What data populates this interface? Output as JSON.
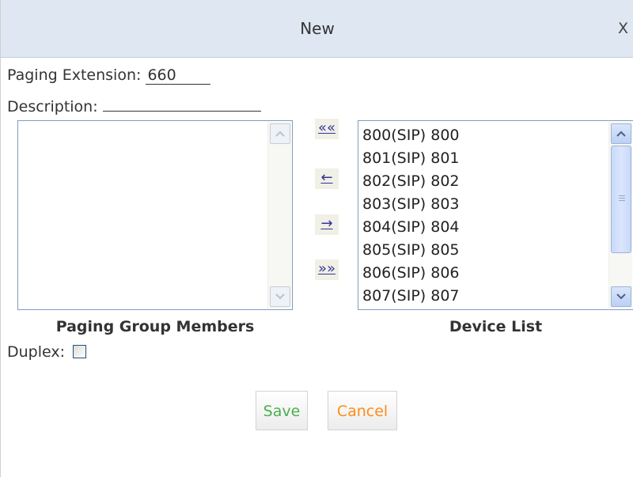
{
  "dialog": {
    "title": "New",
    "close_label": "X"
  },
  "form": {
    "paging_extension_label": "Paging Extension:",
    "paging_extension_value": "660",
    "description_label": "Description:",
    "description_value": "",
    "duplex_label": "Duplex:",
    "duplex_checked": false
  },
  "members": {
    "caption": "Paging Group Members",
    "items": []
  },
  "move_buttons": {
    "add_all": "««",
    "add_one": "←",
    "remove_one": "→",
    "remove_all": "»»"
  },
  "device_list": {
    "caption": "Device List",
    "items": [
      "800(SIP) 800",
      "801(SIP) 801",
      "802(SIP) 802",
      "803(SIP) 803",
      "804(SIP) 804",
      "805(SIP) 805",
      "806(SIP) 806",
      "807(SIP) 807"
    ]
  },
  "actions": {
    "save_label": "Save",
    "cancel_label": "Cancel",
    "save_color": "#4caf50",
    "cancel_color": "#ff8c1a"
  },
  "colors": {
    "titlebar_bg": "#dfe8f2",
    "listbox_border": "#7f9db9",
    "link_color": "#333399"
  }
}
